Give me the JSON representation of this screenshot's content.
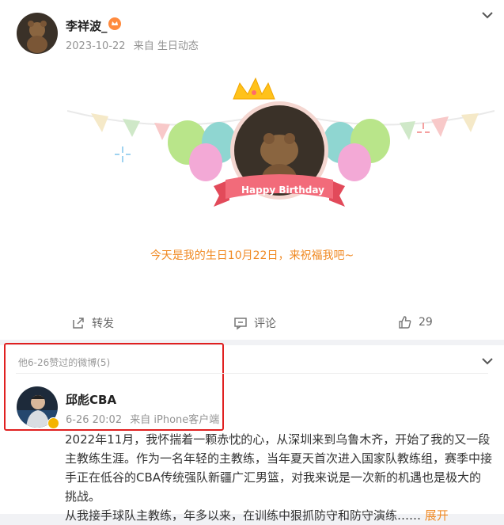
{
  "post1": {
    "author": "李祥波_",
    "date": "2023-10-22",
    "source_label": "来自 生日动态",
    "greeting": "今天是我的生日10月22日，来祝福我吧~",
    "banner_ribbon": "Happy Birthday",
    "actions": {
      "repost": "转发",
      "comment": "评论",
      "like_count": "29"
    }
  },
  "liked_section": {
    "title": "他6-26赞过的微博(5)"
  },
  "post2": {
    "author": "邱彪CBA",
    "date": "6-26 20:02",
    "source_label": "来自 iPhone客户端",
    "body": "2022年11月，我怀揣着一颗赤忱的心，从深圳来到乌鲁木齐，开始了我的又一段主教练生涯。作为一名年轻的主教练，当年夏天首次进入国家队教练组，赛季中接手正在低谷的CBA传统强队新疆广汇男篮，对我来说是一次新的机遇也是极大的挑战。",
    "body_cut": "从我接手球队主教练，年多以来，在训练中狠抓防守和防守演练……",
    "more": "展开"
  },
  "colors": {
    "accent": "#f08a24",
    "highlight_box": "#e02020",
    "verified": "#f4b400"
  }
}
